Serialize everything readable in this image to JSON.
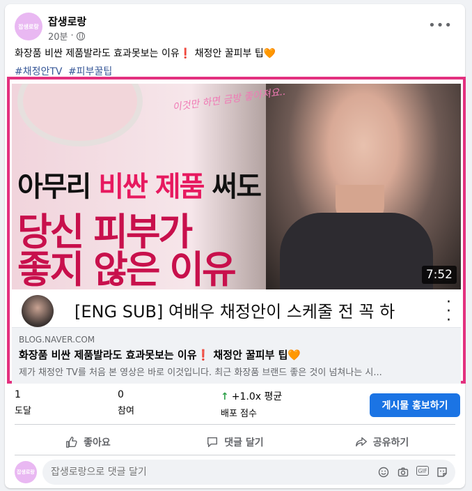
{
  "post": {
    "author": "잡생로랑",
    "avatar_text": "잡생로랑",
    "time": "20분",
    "separator": "·",
    "text": "화장품 비싼 제품발라도 효과못보는 이유❗ 채정안 꿀피부 팁🧡",
    "hashtags": [
      "#채정안TV",
      "#피부꿀팁"
    ]
  },
  "video": {
    "thumbnail_script": "이것만 하면 금방 좋아져요..",
    "thumbnail_line1_a": "아무리 ",
    "thumbnail_line1_b": "비싼 제품",
    "thumbnail_line1_c": " 써도",
    "thumbnail_line2": "당신 피부가",
    "thumbnail_line3": "좋지 않은 이유",
    "duration": "7:52",
    "title": "[ENG SUB] 여배우 채정안이 스케줄 전 꼭 하"
  },
  "link": {
    "domain": "BLOG.NAVER.COM",
    "title": "화장품 비싼 제품발라도 효과못보는 이유❗ 채정안 꿀피부 팁🧡",
    "description": "제가 채정안 TV를 처음 본 영상은 바로 이것입니다. 최근 화장품 브랜드 좋은 것이 넘쳐나는 시..."
  },
  "stats": {
    "reach_value": "1",
    "reach_label": "도달",
    "engagement_value": "0",
    "engagement_label": "참여",
    "distribution_arrow": "↑",
    "distribution_value": "+1.0x 평균",
    "distribution_label": "배포 점수",
    "promote_label": "게시물 홍보하기"
  },
  "actions": {
    "like": "좋아요",
    "comment": "댓글 달기",
    "share": "공유하기"
  },
  "comment_box": {
    "placeholder": "잡생로랑으로 댓글 달기",
    "gif_label": "GIF"
  },
  "colors": {
    "accent": "#1b74e4",
    "highlight": "#e3317f",
    "hashtag": "#385898"
  }
}
